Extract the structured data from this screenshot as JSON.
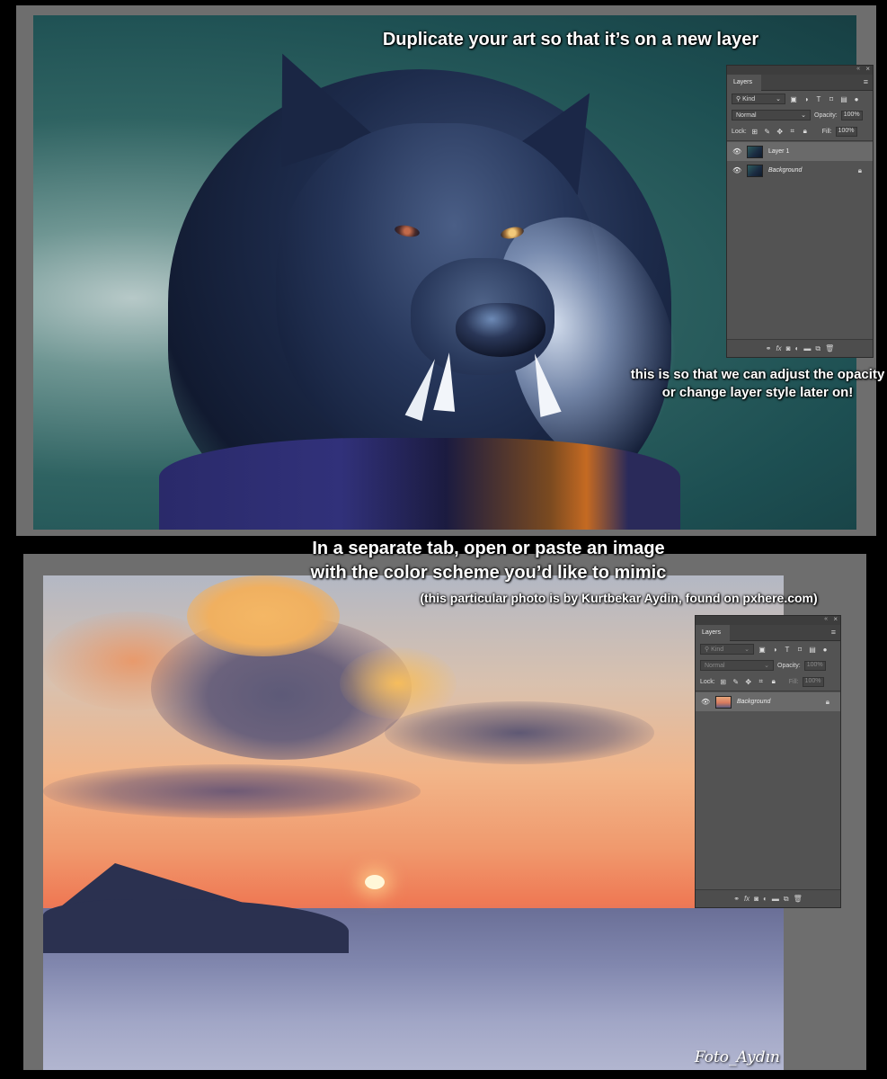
{
  "captions": {
    "duplicate": "Duplicate your art so that it’s on a new layer",
    "adjust": "this is so that we can adjust the opacity or change layer style later on!",
    "separate_line1": "In a separate tab, open or paste an image",
    "separate_line2": "with the color scheme you’d like to mimic",
    "credit": "(this particular photo is by Kurtbekar Aydin, found on pxhere.com)"
  },
  "watermark": "Foto_Aydın",
  "layers_panel_top": {
    "tab": "Layers",
    "filter_kind": "Kind",
    "blend_mode": "Normal",
    "opacity_label": "Opacity:",
    "opacity_value": "100%",
    "lock_label": "Lock:",
    "fill_label": "Fill:",
    "fill_value": "100%",
    "layers": [
      {
        "name": "Layer 1",
        "selected": true
      },
      {
        "name": "Background",
        "locked": true
      }
    ]
  },
  "layers_panel_bottom": {
    "tab": "Layers",
    "filter_kind": "Kind",
    "blend_mode": "Normal",
    "opacity_label": "Opacity:",
    "opacity_value": "100%",
    "lock_label": "Lock:",
    "fill_label": "Fill:",
    "fill_value": "100%",
    "layers": [
      {
        "name": "Background",
        "locked": true
      }
    ]
  },
  "icons": {
    "eye": "eye-icon",
    "lock": "lock-icon",
    "menu": "menu-icon",
    "link": "link-icon",
    "fx": "fx-icon",
    "mask": "mask-icon",
    "adjustment": "adjustment-icon",
    "folder": "folder-icon",
    "new_layer": "new-layer-icon",
    "trash": "trash-icon"
  }
}
